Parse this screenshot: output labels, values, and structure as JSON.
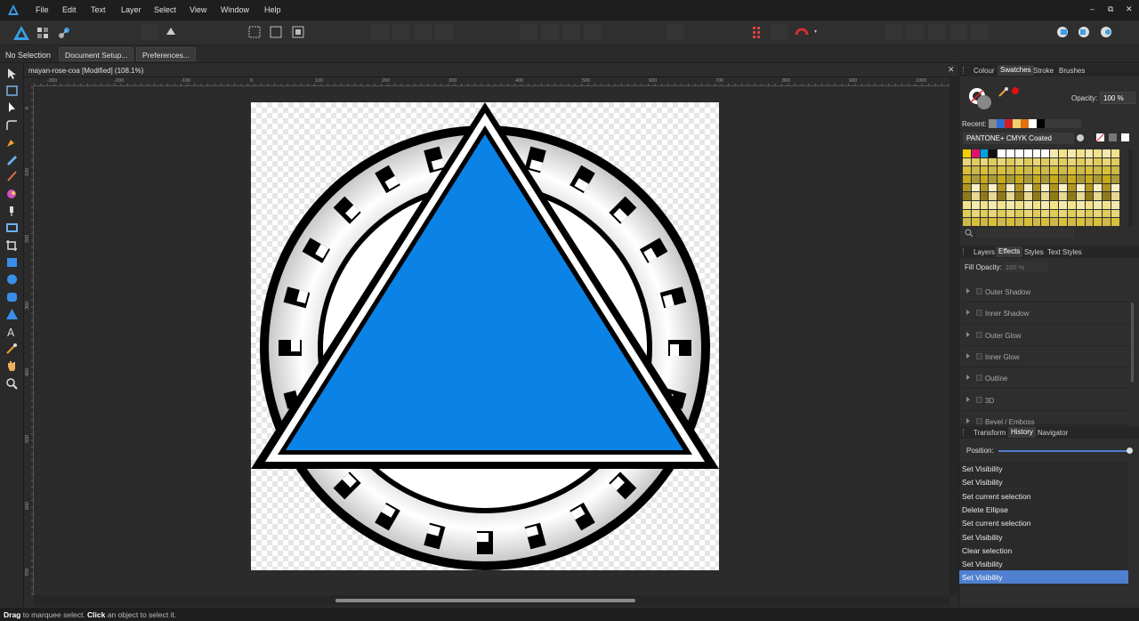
{
  "menubar": {
    "items": [
      "File",
      "Edit",
      "Text",
      "Layer",
      "Select",
      "View",
      "Window",
      "Help"
    ],
    "controls": [
      "–",
      "⧉",
      "✕"
    ]
  },
  "contextbar": {
    "selection": "No Selection",
    "document_setup": "Document Setup...",
    "preferences": "Preferences..."
  },
  "document": {
    "title": "mayan-rose-coa [Modified] (108.1%)",
    "close": "✕",
    "ruler_labels": [
      "-300",
      "-200",
      "-100",
      "0",
      "100",
      "200",
      "300",
      "400",
      "500",
      "600",
      "700",
      "800",
      "900",
      "1000"
    ],
    "vruler_labels": [
      "0",
      "100",
      "200",
      "300",
      "400",
      "500",
      "600",
      "700"
    ]
  },
  "right_panel": {
    "tabs1": [
      "Colour",
      "Swatches",
      "Stroke",
      "Brushes"
    ],
    "active_tab1": "Swatches",
    "opacity_label": "Opacity:",
    "opacity_value": "100 %",
    "recent_label": "Recent:",
    "palette_name": "PANTONE+ CMYK Coated",
    "tabs2": [
      "Layers",
      "Effects",
      "Styles",
      "Text Styles"
    ],
    "active_tab2": "Effects",
    "fill_opacity_label": "Fill Opacity:",
    "fill_opacity_value": "100 %",
    "effects": [
      "Outer Shadow",
      "Inner Shadow",
      "Outer Glow",
      "Inner Glow",
      "Outline",
      "3D",
      "Bevel / Emboss"
    ],
    "tabs3": [
      "Transform",
      "History",
      "Navigator"
    ],
    "active_tab3": "History",
    "position_label": "Position:",
    "history": [
      "Set Visibility",
      "Set Visibility",
      "Set current selection",
      "Delete Ellipse",
      "Set current selection",
      "Set Visibility",
      "Clear selection",
      "Set Visibility",
      "Set Visibility"
    ]
  },
  "status": {
    "drag": "Drag",
    "drag_text": " to marquee select. ",
    "click": "Click",
    "click_text": " an object to select it."
  },
  "colors": {
    "accent": "#4f7fcf",
    "triangle_fill": "#0a82e6"
  }
}
